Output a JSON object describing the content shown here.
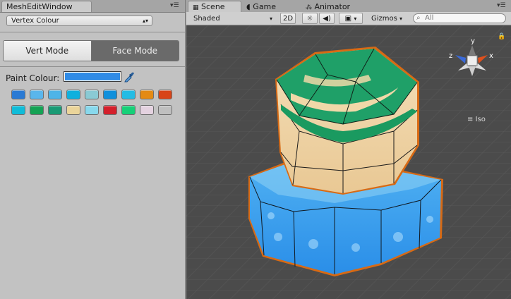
{
  "mesh_edit_window": {
    "tab_title": "MeshEditWindow",
    "mode_dropdown": "Vertex Colour",
    "vert_mode_label": "Vert Mode",
    "face_mode_label": "Face Mode",
    "paint_colour_label": "Paint Colour:",
    "paint_colour_value": "#2f8be6",
    "swatch_rows": [
      [
        "#2a7ad4",
        "#5ab6ec",
        "#4eb4e8",
        "#0fb0de",
        "#8acad4",
        "#1090dc",
        "#24bce4",
        "#e48a14",
        "#d84418"
      ],
      [
        "#10bcd8",
        "#14a254",
        "#1a9a74",
        "#ead49a",
        "#88d8ec",
        "#d4202c",
        "#16d078",
        "#e4d2e0",
        "#bfbfbf"
      ]
    ]
  },
  "scene_window": {
    "tabs": [
      {
        "label": "Scene",
        "icon": "grid-icon",
        "active": true
      },
      {
        "label": "Game",
        "icon": "pacman-icon",
        "active": false
      },
      {
        "label": "Animator",
        "icon": "animator-icon",
        "active": false
      }
    ],
    "toolbar": {
      "shading_mode": "Shaded",
      "view_2d": "2D",
      "gizmos": "Gizmos",
      "search_placeholder": "All"
    },
    "gizmo": {
      "x_label": "x",
      "y_label": "y",
      "z_label": "z",
      "projection": "Iso"
    }
  }
}
